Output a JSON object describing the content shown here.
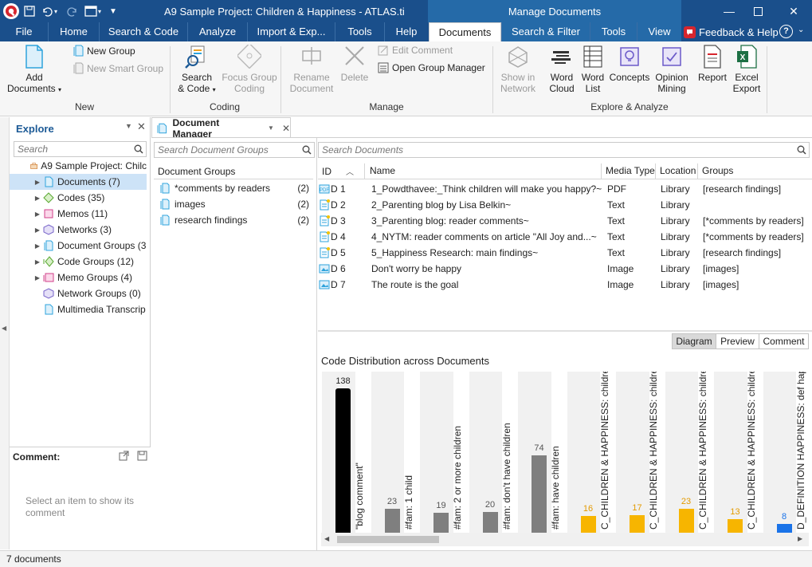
{
  "titlebar": {
    "title": "A9 Sample Project: Children & Happiness - ATLAS.ti",
    "context_title": "Manage Documents"
  },
  "menu": {
    "file": "File",
    "home": "Home",
    "search_code": "Search & Code",
    "analyze": "Analyze",
    "import_export": "Import & Exp...",
    "tools": "Tools",
    "help": "Help",
    "documents": "Documents",
    "search_filter": "Search & Filter",
    "tools2": "Tools",
    "view": "View",
    "feedback": "Feedback & Help"
  },
  "ribbon": {
    "add_documents_1": "Add",
    "add_documents_2": "Documents",
    "new_group": "New Group",
    "new_smart_group": "New Smart Group",
    "group_new": "New",
    "search_code_1": "Search",
    "search_code_2": "& Code",
    "focus_group_1": "Focus Group",
    "focus_group_2": "Coding",
    "group_coding": "Coding",
    "rename_1": "Rename",
    "rename_2": "Document",
    "delete": "Delete",
    "edit_comment": "Edit Comment",
    "open_group_manager": "Open Group Manager",
    "group_manage": "Manage",
    "show_network_1": "Show in",
    "show_network_2": "Network",
    "word_cloud_1": "Word",
    "word_cloud_2": "Cloud",
    "word_list_1": "Word",
    "word_list_2": "List",
    "concepts": "Concepts",
    "opinion_1": "Opinion",
    "opinion_2": "Mining",
    "report": "Report",
    "excel_1": "Excel",
    "excel_2": "Export",
    "group_explore": "Explore & Analyze"
  },
  "explore": {
    "title": "Explore",
    "search_placeholder": "Search",
    "project": "A9 Sample Project: Chilc",
    "items": [
      {
        "label": "Documents (7)"
      },
      {
        "label": "Codes (35)"
      },
      {
        "label": "Memos (11)"
      },
      {
        "label": "Networks (3)"
      },
      {
        "label": "Document Groups (3"
      },
      {
        "label": "Code Groups (12)"
      },
      {
        "label": "Memo Groups (4)"
      },
      {
        "label": "Network Groups (0)"
      },
      {
        "label": "Multimedia Transcrip"
      }
    ]
  },
  "comment": {
    "title": "Comment:",
    "placeholder": "Select an item to show its comment"
  },
  "doc_manager": {
    "tab_title": "Document Manager",
    "search_groups": "Search Document Groups",
    "search_docs": "Search Documents",
    "groups_header": "Document Groups",
    "groups": [
      {
        "name": "*comments by readers",
        "count": "(2)"
      },
      {
        "name": "images",
        "count": "(2)"
      },
      {
        "name": "research findings",
        "count": "(2)"
      }
    ],
    "columns": {
      "id": "ID",
      "name": "Name",
      "media": "Media Type",
      "location": "Location",
      "groups": "Groups"
    },
    "rows": [
      {
        "id": "D 1",
        "name": "1_Powdthavee:_Think children will make you happy?~",
        "media": "PDF",
        "location": "Library",
        "groups": "[research findings]"
      },
      {
        "id": "D 2",
        "name": "2_Parenting blog by Lisa Belkin~",
        "media": "Text",
        "location": "Library",
        "groups": ""
      },
      {
        "id": "D 3",
        "name": "3_Parenting blog: reader comments~",
        "media": "Text",
        "location": "Library",
        "groups": "[*comments by readers]"
      },
      {
        "id": "D 4",
        "name": "4_NYTM: reader comments on article \"All Joy and...~",
        "media": "Text",
        "location": "Library",
        "groups": "[*comments by readers]"
      },
      {
        "id": "D 5",
        "name": "5_Happiness Research: main findings~",
        "media": "Text",
        "location": "Library",
        "groups": "[research findings]"
      },
      {
        "id": "D 6",
        "name": "Don't worry be happy",
        "media": "Image",
        "location": "Library",
        "groups": "[images]"
      },
      {
        "id": "D 7",
        "name": "The route is the goal",
        "media": "Image",
        "location": "Library",
        "groups": "[images]"
      }
    ],
    "view_tabs": {
      "diagram": "Diagram",
      "preview": "Preview",
      "comment": "Comment"
    }
  },
  "chart_data": {
    "type": "bar",
    "title": "Code Distribution across Documents",
    "categories": [
      "\"blog comment\"",
      "#fam: 1 child",
      "#fam: 2 or more  children",
      "#fam: don't have children",
      "#fam: have children",
      "C_CHILDREN & HAPPINESS: childre",
      "C_CHILDREN & HAPPINESS: childre",
      "C_CHILDREN & HAPPINESS: childre",
      "C_CHILDREN & HAPPINESS: childre",
      "D_DEFINITION HAPPINESS: def hap"
    ],
    "values": [
      138,
      23,
      19,
      20,
      74,
      16,
      17,
      23,
      13,
      8
    ],
    "colors": [
      "#000000",
      "#7f7f7f",
      "#7f7f7f",
      "#7f7f7f",
      "#7f7f7f",
      "#f7b500",
      "#f7b500",
      "#f7b500",
      "#f7b500",
      "#1a73e8"
    ],
    "value_colors": [
      "#222222",
      "#555555",
      "#555555",
      "#555555",
      "#555555",
      "#e39a00",
      "#e39a00",
      "#e39a00",
      "#e39a00",
      "#1a73e8"
    ],
    "ylim": [
      0,
      140
    ]
  },
  "statusbar": {
    "text": "7 documents"
  }
}
